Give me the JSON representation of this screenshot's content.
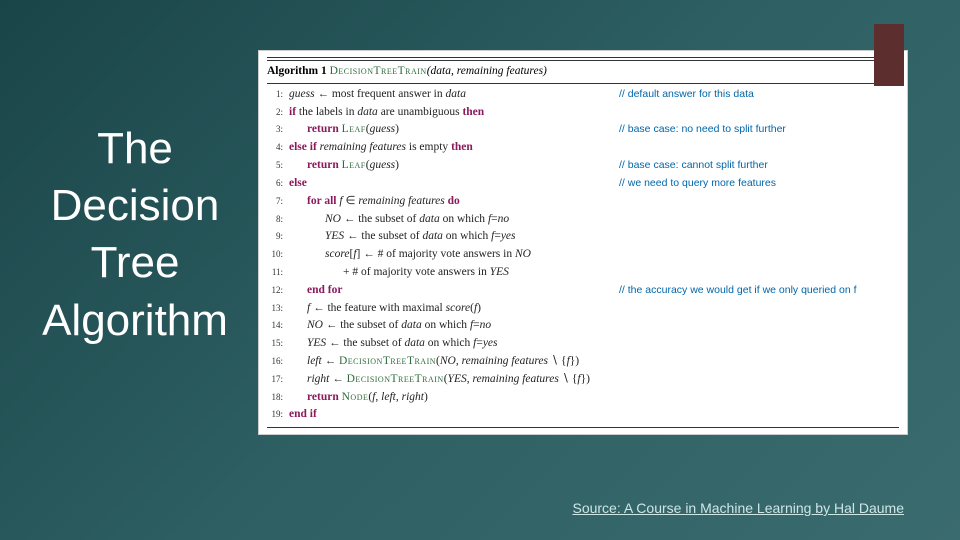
{
  "title": "The Decision Tree Algorithm",
  "source": "Source: A Course in Machine Learning by Hal Daume",
  "algo": {
    "header_label": "Algorithm 1",
    "header_fn": "DecisionTreeTrain",
    "header_args": "(data, remaining features)",
    "lines": [
      {
        "n": "1:",
        "indent": 0,
        "html": "<span class='it'>guess</span> ← most frequent answer in <span class='it'>data</span>",
        "comment": "// default answer for this data"
      },
      {
        "n": "2:",
        "indent": 0,
        "html": "<span class='kw'>if</span> the labels in <span class='it'>data</span> are unambiguous <span class='kw'>then</span>",
        "comment": ""
      },
      {
        "n": "3:",
        "indent": 1,
        "html": "<span class='kw'>return</span> <span class='fn'>Leaf</span>(<span class='it'>guess</span>)",
        "comment": "// base case: no need to split further"
      },
      {
        "n": "4:",
        "indent": 0,
        "html": "<span class='kw'>else if</span> <span class='it'>remaining features</span> is empty <span class='kw'>then</span>",
        "comment": ""
      },
      {
        "n": "5:",
        "indent": 1,
        "html": "<span class='kw'>return</span> <span class='fn'>Leaf</span>(<span class='it'>guess</span>)",
        "comment": "// base case: cannot split further"
      },
      {
        "n": "6:",
        "indent": 0,
        "html": "<span class='kw'>else</span>",
        "comment": "// we need to query more features"
      },
      {
        "n": "7:",
        "indent": 1,
        "html": "<span class='kw'>for all</span> <span class='it'>f</span> ∈ <span class='it'>remaining features</span> <span class='kw'>do</span>",
        "comment": ""
      },
      {
        "n": "8:",
        "indent": 2,
        "html": "<span class='it'>NO</span> ← the subset of <span class='it'>data</span> on which <span class='it'>f</span>=<span class='it'>no</span>",
        "comment": ""
      },
      {
        "n": "9:",
        "indent": 2,
        "html": "<span class='it'>YES</span> ← the subset of <span class='it'>data</span> on which <span class='it'>f</span>=<span class='it'>yes</span>",
        "comment": ""
      },
      {
        "n": "10:",
        "indent": 2,
        "html": "<span class='it'>score</span>[<span class='it'>f</span>] ← # of majority vote answers in <span class='it'>NO</span>",
        "comment": ""
      },
      {
        "n": "11:",
        "indent": 3,
        "html": "+ # of majority vote answers in <span class='it'>YES</span>",
        "comment": ""
      },
      {
        "n": "",
        "indent": 3,
        "html": "",
        "comment": "// the accuracy we would get if we only queried on f"
      },
      {
        "n": "12:",
        "indent": 1,
        "html": "<span class='kw'>end for</span>",
        "comment": ""
      },
      {
        "n": "13:",
        "indent": 1,
        "html": "<span class='it'>f</span> ← the feature with maximal <span class='it'>score</span>(<span class='it'>f</span>)",
        "comment": ""
      },
      {
        "n": "14:",
        "indent": 1,
        "html": "<span class='it'>NO</span> ← the subset of <span class='it'>data</span> on which <span class='it'>f</span>=<span class='it'>no</span>",
        "comment": ""
      },
      {
        "n": "15:",
        "indent": 1,
        "html": "<span class='it'>YES</span> ← the subset of <span class='it'>data</span> on which <span class='it'>f</span>=<span class='it'>yes</span>",
        "comment": ""
      },
      {
        "n": "16:",
        "indent": 1,
        "html": "<span class='it'>left</span> ← <span class='fn'>DecisionTreeTrain</span>(<span class='it'>NO</span>, <span class='it'>remaining features</span> ∖ {<span class='it'>f</span>})",
        "comment": ""
      },
      {
        "n": "17:",
        "indent": 1,
        "html": "<span class='it'>right</span> ← <span class='fn'>DecisionTreeTrain</span>(<span class='it'>YES</span>, <span class='it'>remaining features</span> ∖ {<span class='it'>f</span>})",
        "comment": ""
      },
      {
        "n": "18:",
        "indent": 1,
        "html": "<span class='kw'>return</span> <span class='fn'>Node</span>(<span class='it'>f</span>, <span class='it'>left</span>, <span class='it'>right</span>)",
        "comment": ""
      },
      {
        "n": "19:",
        "indent": 0,
        "html": "<span class='kw'>end if</span>",
        "comment": ""
      }
    ]
  }
}
